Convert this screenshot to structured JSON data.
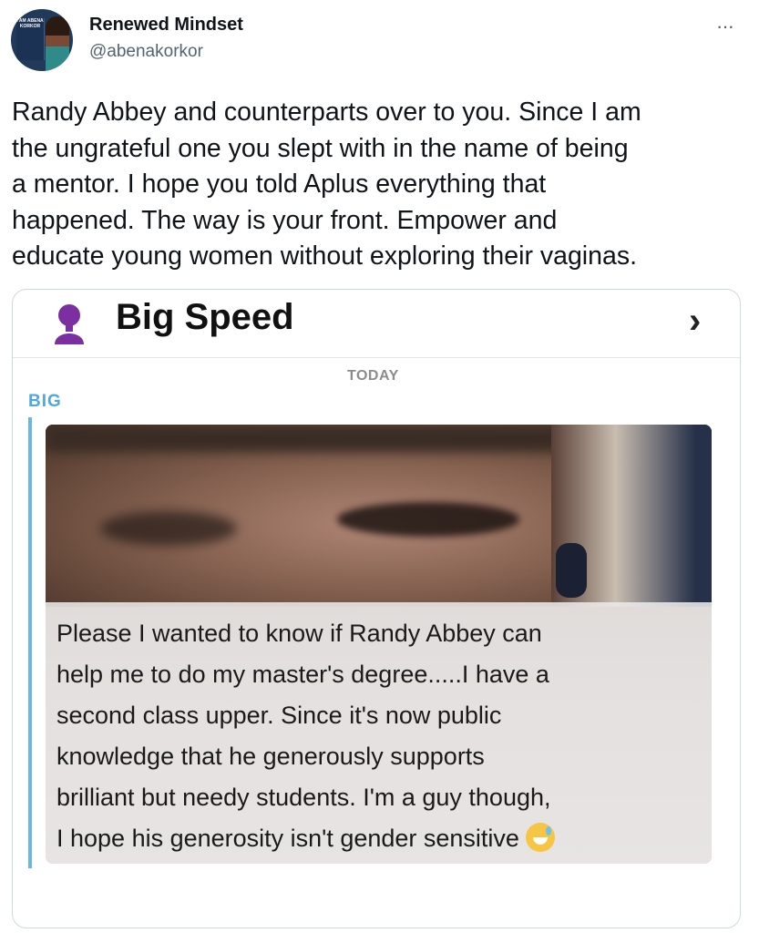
{
  "tweet": {
    "author_name": "Renewed Mindset",
    "author_handle": "@abenakorkor",
    "more_label": "···",
    "text": "Randy Abbey and counterparts over to you. Since I am\nthe ungrateful one you slept with in the name of being\na mentor. I hope you told Aplus everything that\nhappened. The way is your front. Empower and\neducate young women without exploring their vaginas.",
    "avatar_book_text": "I AM ABENA KORKOR"
  },
  "media": {
    "chat_name": "Big Speed",
    "chevron": "›",
    "date_label": "TODAY",
    "sender": "BIG",
    "caption": "Please I wanted to know if Randy Abbey can\nhelp me to do my master's degree.....I have a\nsecond class upper. Since it's now public\nknowledge that he generously supports\nbrilliant but needy students.  I'm a guy though,\nI hope his generosity isn't gender sensitive",
    "caption_emoji": "sweat-smile-emoji",
    "colors": {
      "bitmoji": "#7b2fa0",
      "sender_blue": "#4ea8dd"
    }
  }
}
